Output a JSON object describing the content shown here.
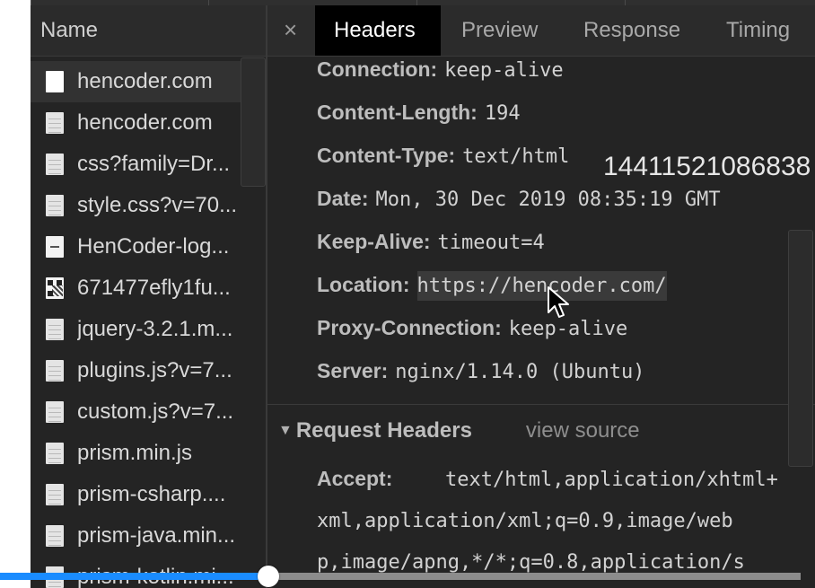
{
  "network_panel": {
    "name_column_header": "Name",
    "files": [
      {
        "name": "hencoder.com",
        "icon": "document-icon",
        "selected": true
      },
      {
        "name": "hencoder.com",
        "icon": "file-icon",
        "selected": false
      },
      {
        "name": "css?family=Dr...",
        "icon": "file-icon",
        "selected": false
      },
      {
        "name": "style.css?v=70...",
        "icon": "file-icon",
        "selected": false
      },
      {
        "name": "HenCoder-log...",
        "icon": "image-logo-icon",
        "selected": false
      },
      {
        "name": "671477efly1fu...",
        "icon": "image-qr-icon",
        "selected": false
      },
      {
        "name": "jquery-3.2.1.m...",
        "icon": "file-icon",
        "selected": false
      },
      {
        "name": "plugins.js?v=7...",
        "icon": "file-icon",
        "selected": false
      },
      {
        "name": "custom.js?v=7...",
        "icon": "file-icon",
        "selected": false
      },
      {
        "name": "prism.min.js",
        "icon": "file-icon",
        "selected": false
      },
      {
        "name": "prism-csharp....",
        "icon": "file-icon",
        "selected": false
      },
      {
        "name": "prism-java.min...",
        "icon": "file-icon",
        "selected": false
      },
      {
        "name": "prism-kotlin.mi...",
        "icon": "file-icon",
        "selected": false
      }
    ]
  },
  "detail_panel": {
    "close_symbol": "×",
    "tabs": [
      {
        "label": "Headers",
        "active": true
      },
      {
        "label": "Preview",
        "active": false
      },
      {
        "label": "Response",
        "active": false
      },
      {
        "label": "Timing",
        "active": false
      }
    ],
    "response_headers": [
      {
        "key": "Connection:",
        "value": "keep-alive"
      },
      {
        "key": "Content-Length:",
        "value": "194"
      },
      {
        "key": "Content-Type:",
        "value": "text/html"
      },
      {
        "key": "Date:",
        "value": "Mon, 30 Dec 2019 08:35:19 GMT"
      },
      {
        "key": "Keep-Alive:",
        "value": "timeout=4"
      },
      {
        "key": "Location:",
        "value": "https://hencoder.com/"
      },
      {
        "key": "Proxy-Connection:",
        "value": "keep-alive"
      },
      {
        "key": "Server:",
        "value": "nginx/1.14.0 (Ubuntu)"
      }
    ],
    "overlay_number": "14411521086838",
    "request_headers": {
      "title": "Request Headers",
      "view_source": "view source",
      "accept_key": "Accept:",
      "accept_value_lines": [
        "text/html,application/xhtml+",
        "xml,application/xml;q=0.9,image/web",
        "p,image/apng,*/*;q=0.8,application/s"
      ]
    }
  },
  "video_progress": {
    "fraction": 0.335
  },
  "colors": {
    "panel_bg": "#242424",
    "active_tab_bg": "#000000",
    "progress_fill": "#1a8cff",
    "progress_track": "#8c8c8c"
  }
}
